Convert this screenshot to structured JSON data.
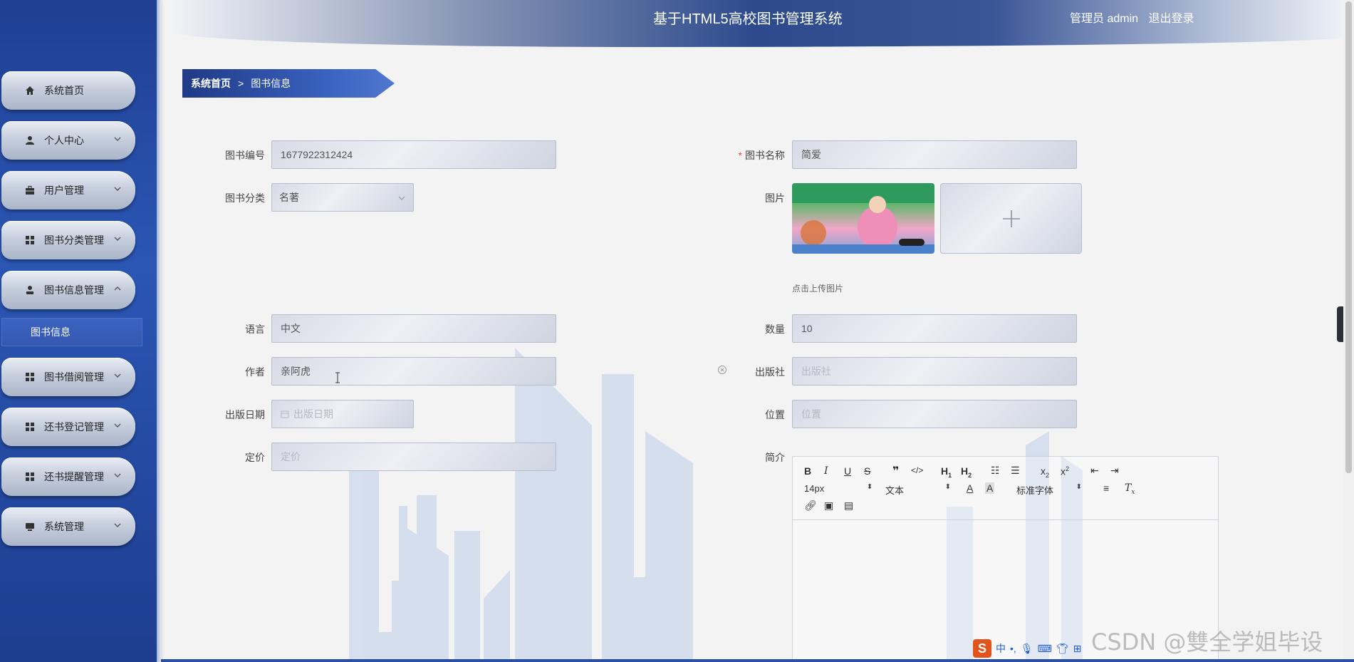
{
  "header": {
    "title": "基于HTML5高校图书管理系统",
    "user_label": "管理员 admin",
    "logout_label": "退出登录"
  },
  "sidebar": {
    "items": [
      {
        "label": "系统首页",
        "icon": "home-icon",
        "has_children": false
      },
      {
        "label": "个人中心",
        "icon": "user-icon",
        "has_children": true
      },
      {
        "label": "用户管理",
        "icon": "briefcase-icon",
        "has_children": true
      },
      {
        "label": "图书分类管理",
        "icon": "grid-icon",
        "has_children": true
      },
      {
        "label": "图书信息管理",
        "icon": "person-icon",
        "has_children": true,
        "expanded": true,
        "children": [
          {
            "label": "图书信息"
          }
        ]
      },
      {
        "label": "图书借阅管理",
        "icon": "grid-icon",
        "has_children": true
      },
      {
        "label": "还书登记管理",
        "icon": "grid-icon",
        "has_children": true
      },
      {
        "label": "还书提醒管理",
        "icon": "grid-icon",
        "has_children": true
      },
      {
        "label": "系统管理",
        "icon": "monitor-icon",
        "has_children": true
      }
    ]
  },
  "breadcrumb": {
    "home": "系统首页",
    "separator": ">",
    "current": "图书信息"
  },
  "form": {
    "book_number": {
      "label": "图书编号",
      "value": "1677922312424"
    },
    "book_name": {
      "label": "图书名称",
      "value": "简爱",
      "required": true
    },
    "category": {
      "label": "图书分类",
      "value": "名著"
    },
    "image": {
      "label": "图片",
      "upload_hint": "点击上传图片"
    },
    "language": {
      "label": "语言",
      "value": "中文"
    },
    "quantity": {
      "label": "数量",
      "value": "10"
    },
    "author": {
      "label": "作者",
      "value": "亲阿虎"
    },
    "publisher": {
      "label": "出版社",
      "placeholder": "出版社"
    },
    "publish_date": {
      "label": "出版日期",
      "placeholder": "出版日期"
    },
    "location": {
      "label": "位置",
      "placeholder": "位置"
    },
    "price": {
      "label": "定价",
      "placeholder": "定价"
    },
    "intro": {
      "label": "简介"
    }
  },
  "editor": {
    "font_size": "14px",
    "paragraph": "文本",
    "font_family": "标准字体"
  },
  "watermark": "CSDN @雙全学姐毕设",
  "ime": {
    "lang": "中"
  },
  "colors": {
    "sidebar": "#2b56b4",
    "accent": "#3b63c0",
    "required": "#e04b4b"
  }
}
